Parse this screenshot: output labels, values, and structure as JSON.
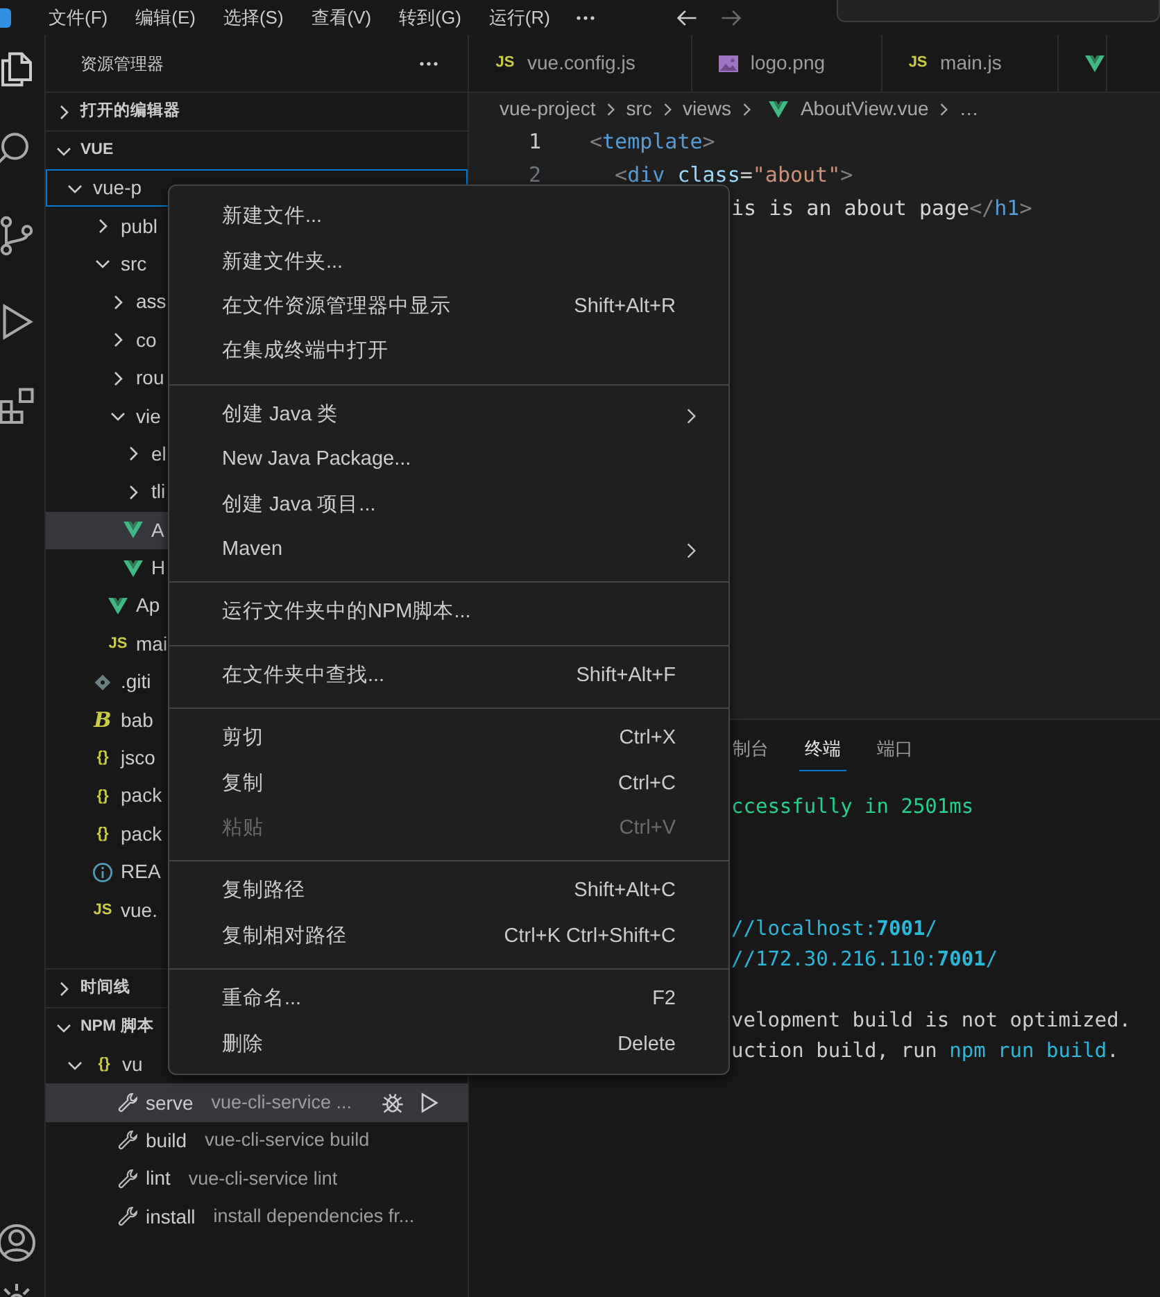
{
  "title_bar": {
    "menus": [
      "文件(F)",
      "编辑(E)",
      "选择(S)",
      "查看(V)",
      "转到(G)",
      "运行(R)"
    ]
  },
  "explorer": {
    "title": "资源管理器",
    "sections": [
      {
        "kind": "editors",
        "title": "打开的编辑器",
        "expanded": false
      },
      {
        "kind": "files",
        "title": "VUE",
        "expanded": true,
        "tree": [
          {
            "kind": "folder",
            "label": "vue-p",
            "expanded": true,
            "selected": false,
            "focused": true,
            "children": [
              {
                "kind": "folder",
                "label": "publ",
                "expanded": false,
                "selected": false,
                "focused": false
              },
              {
                "kind": "folder",
                "label": "src",
                "expanded": true,
                "selected": false,
                "focused": false,
                "children": [
                  {
                    "kind": "folder",
                    "label": "ass",
                    "expanded": false,
                    "selected": false,
                    "focused": false
                  },
                  {
                    "kind": "folder",
                    "label": "co",
                    "expanded": false,
                    "selected": false,
                    "focused": false
                  },
                  {
                    "kind": "folder",
                    "label": "rou",
                    "expanded": false,
                    "selected": false,
                    "focused": false
                  },
                  {
                    "kind": "folder",
                    "label": "vie",
                    "expanded": true,
                    "selected": false,
                    "focused": false,
                    "children": [
                      {
                        "kind": "folder",
                        "label": "el",
                        "expanded": false,
                        "selected": false,
                        "focused": false
                      },
                      {
                        "kind": "folder",
                        "label": "tli",
                        "expanded": false,
                        "selected": false,
                        "focused": false
                      },
                      {
                        "kind": "vue",
                        "label": "A",
                        "selected": true,
                        "focused": false
                      },
                      {
                        "kind": "vue",
                        "label": "H",
                        "selected": false,
                        "focused": false
                      }
                    ]
                  },
                  {
                    "kind": "vue",
                    "label": "Ap",
                    "selected": false,
                    "focused": false
                  },
                  {
                    "kind": "js",
                    "icon_text": "JS",
                    "label": "mai",
                    "selected": false,
                    "focused": false
                  }
                ]
              },
              {
                "kind": "git",
                "label": ".giti",
                "selected": false,
                "focused": false
              },
              {
                "kind": "babel",
                "icon_text": "B",
                "label": "bab",
                "selected": false,
                "focused": false
              },
              {
                "kind": "json",
                "icon_text": "{}",
                "label": "jsco",
                "selected": false,
                "focused": false
              },
              {
                "kind": "json",
                "icon_text": "{}",
                "label": "pack",
                "selected": false,
                "focused": false
              },
              {
                "kind": "json",
                "icon_text": "{}",
                "label": "pack",
                "selected": false,
                "focused": false
              },
              {
                "kind": "info",
                "label": "REA",
                "selected": false,
                "focused": false
              },
              {
                "kind": "js",
                "icon_text": "JS",
                "label": "vue.",
                "selected": false,
                "focused": false
              }
            ]
          }
        ]
      },
      {
        "kind": "timeline",
        "title": "时间线",
        "expanded": false
      },
      {
        "kind": "npm",
        "title": "NPM 脚本",
        "expanded": true,
        "tree": [
          {
            "kind": "package",
            "icon_text": "{}",
            "label": "vu",
            "expanded": true,
            "selected": false,
            "focused": false,
            "children": [
              {
                "kind": "script",
                "label": "serve",
                "detail": "vue-cli-service ...",
                "selected": true,
                "focused": false,
                "hovered": true
              },
              {
                "kind": "script",
                "label": "build",
                "detail": "vue-cli-service build",
                "selected": false,
                "focused": false,
                "hovered": false
              },
              {
                "kind": "script",
                "label": "lint",
                "detail": "vue-cli-service lint",
                "selected": false,
                "focused": false,
                "hovered": false
              },
              {
                "kind": "script",
                "label": "install",
                "detail": "install dependencies fr...",
                "selected": false,
                "focused": false,
                "hovered": false
              }
            ]
          }
        ]
      }
    ]
  },
  "editor": {
    "tabs": [
      {
        "kind": "js",
        "icon_text": "JS",
        "label": "vue.config.js"
      },
      {
        "kind": "image",
        "label": "logo.png"
      },
      {
        "kind": "js",
        "icon_text": "JS",
        "label": "main.js"
      },
      {
        "kind": "vue"
      }
    ],
    "breadcrumb": [
      {
        "label": "vue-project"
      },
      {
        "label": "src"
      },
      {
        "label": "views"
      },
      {
        "kind": "vue",
        "label": "AboutView.vue"
      },
      {
        "label": "…"
      }
    ],
    "lines": [
      {
        "number": "1",
        "tokens": [
          {
            "kind": "bracket",
            "text": "<"
          },
          {
            "kind": "tag",
            "text": "template"
          },
          {
            "kind": "bracket",
            "text": ">"
          }
        ]
      },
      {
        "number": "2",
        "tokens": [
          {
            "kind": "bracket",
            "text": "  <"
          },
          {
            "kind": "tag",
            "text": "div"
          },
          {
            "kind": "attr",
            "text": " class"
          },
          {
            "kind": "text",
            "text": "="
          },
          {
            "kind": "string",
            "text": "\"about\""
          },
          {
            "kind": "bracket",
            "text": ">"
          }
        ]
      },
      {
        "covered": true,
        "tokens": [
          {
            "kind": "text",
            "text": "is is an about page"
          },
          {
            "kind": "bracket",
            "text": "</"
          },
          {
            "kind": "tag",
            "text": "h1"
          },
          {
            "kind": "bracket",
            "text": ">"
          }
        ]
      }
    ]
  },
  "panel": {
    "tabs": [
      {
        "label": "制台",
        "selected": false
      },
      {
        "label": "终端",
        "selected": true
      },
      {
        "label": "端口",
        "selected": false
      }
    ],
    "terminal": [
      {
        "kind": "text",
        "parts": [
          {
            "kind": "success",
            "text": "ccessfully in 2501ms"
          }
        ]
      },
      {
        "kind": "blank"
      },
      {
        "kind": "blank"
      },
      {
        "kind": "blank"
      },
      {
        "kind": "text",
        "parts": [
          {
            "kind": "link",
            "text": "//localhost:**7001**/"
          }
        ]
      },
      {
        "kind": "text",
        "parts": [
          {
            "kind": "link",
            "text": "//172.30.216.110:**7001**/"
          }
        ]
      },
      {
        "kind": "blank"
      },
      {
        "kind": "text",
        "parts": [
          {
            "kind": "plain",
            "text": "velopment build is not optimized."
          }
        ]
      },
      {
        "kind": "text",
        "parts": [
          {
            "kind": "plain",
            "text": "uction build, run "
          },
          {
            "kind": "command",
            "text": "npm run build"
          },
          {
            "kind": "plain",
            "text": "."
          }
        ]
      }
    ]
  },
  "context_menu": {
    "groups": [
      [
        {
          "label": "新建文件...",
          "submenu": false,
          "disabled": false
        },
        {
          "label": "新建文件夹...",
          "submenu": false,
          "disabled": false
        },
        {
          "label": "在文件资源管理器中显示",
          "shortcut": "Shift+Alt+R",
          "submenu": false,
          "disabled": false
        },
        {
          "label": "在集成终端中打开",
          "submenu": false,
          "disabled": false
        }
      ],
      [
        {
          "label": "创建 Java 类",
          "submenu": true,
          "disabled": false
        },
        {
          "label": "New Java Package...",
          "submenu": false,
          "disabled": false
        },
        {
          "label": "创建 Java 项目...",
          "submenu": false,
          "disabled": false
        },
        {
          "label": "Maven",
          "submenu": true,
          "disabled": false
        }
      ],
      [
        {
          "label": "运行文件夹中的NPM脚本...",
          "submenu": false,
          "disabled": false
        }
      ],
      [
        {
          "label": "在文件夹中查找...",
          "shortcut": "Shift+Alt+F",
          "submenu": false,
          "disabled": false
        }
      ],
      [
        {
          "label": "剪切",
          "shortcut": "Ctrl+X",
          "submenu": false,
          "disabled": false
        },
        {
          "label": "复制",
          "shortcut": "Ctrl+C",
          "submenu": false,
          "disabled": false
        },
        {
          "label": "粘贴",
          "shortcut": "Ctrl+V",
          "submenu": false,
          "disabled": true
        }
      ],
      [
        {
          "label": "复制路径",
          "shortcut": "Shift+Alt+C",
          "submenu": false,
          "disabled": false
        },
        {
          "label": "复制相对路径",
          "shortcut": "Ctrl+K Ctrl+Shift+C",
          "submenu": false,
          "disabled": false
        }
      ],
      [
        {
          "label": "重命名...",
          "shortcut": "F2",
          "submenu": false,
          "disabled": false
        },
        {
          "label": "删除",
          "shortcut": "Delete",
          "submenu": false,
          "disabled": false
        }
      ]
    ]
  }
}
